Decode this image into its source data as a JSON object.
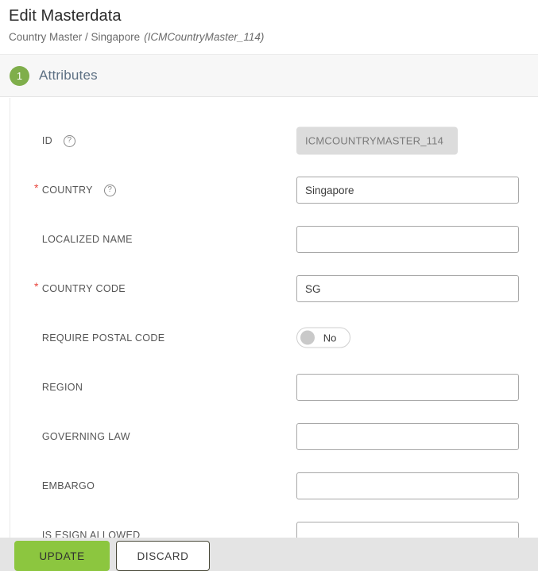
{
  "header": {
    "title": "Edit Masterdata",
    "breadcrumb_main": "Country Master / Singapore",
    "breadcrumb_id": "(ICMCountryMaster_114)"
  },
  "step": {
    "number": "1",
    "label": "Attributes",
    "badge_color": "#7fae4b"
  },
  "form": {
    "fields": [
      {
        "label": "ID",
        "required": false,
        "has_help": true,
        "control": "readonly-text",
        "value": "ICMCOUNTRYMASTER_114",
        "placeholder": ""
      },
      {
        "label": "COUNTRY",
        "required": true,
        "has_help": true,
        "control": "text",
        "value": "Singapore",
        "placeholder": ""
      },
      {
        "label": "LOCALIZED NAME",
        "required": false,
        "has_help": false,
        "control": "text",
        "value": "",
        "placeholder": ""
      },
      {
        "label": "COUNTRY CODE",
        "required": true,
        "has_help": false,
        "control": "text",
        "value": "SG",
        "placeholder": ""
      },
      {
        "label": "REQUIRE POSTAL CODE",
        "required": false,
        "has_help": false,
        "control": "toggle",
        "value": "No",
        "placeholder": ""
      },
      {
        "label": "REGION",
        "required": false,
        "has_help": false,
        "control": "text",
        "value": "",
        "placeholder": ""
      },
      {
        "label": "GOVERNING LAW",
        "required": false,
        "has_help": false,
        "control": "text",
        "value": "",
        "placeholder": ""
      },
      {
        "label": "EMBARGO",
        "required": false,
        "has_help": false,
        "control": "text",
        "value": "",
        "placeholder": ""
      },
      {
        "label": "IS ESIGN ALLOWED",
        "required": false,
        "has_help": false,
        "control": "text",
        "value": "",
        "placeholder": ""
      }
    ],
    "required_marker": "*",
    "help_glyph": "?"
  },
  "actions": {
    "update_label": "UPDATE",
    "discard_label": "DISCARD",
    "update_color": "#8cc63f"
  }
}
